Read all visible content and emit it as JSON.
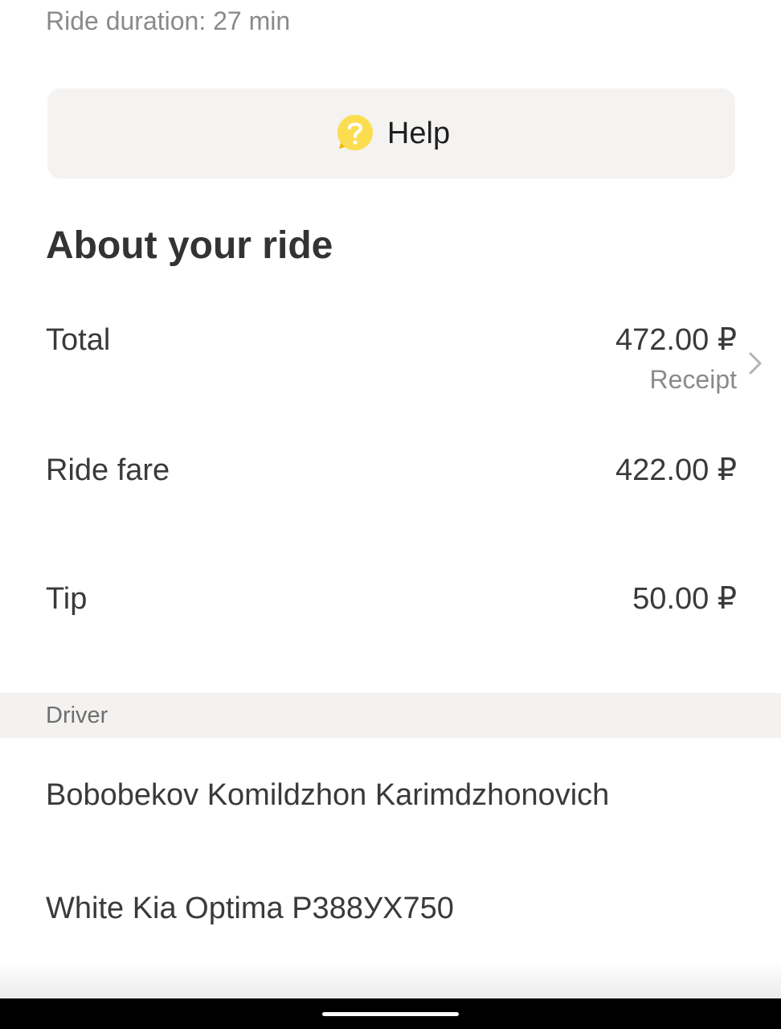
{
  "ride": {
    "duration_text": "Ride duration: 27 min"
  },
  "help_button": {
    "label": "Help",
    "icon": "question-bubble-icon",
    "icon_color": "#fcdd4f"
  },
  "about": {
    "title": "About your ride",
    "total": {
      "label": "Total",
      "value": "472.00 ₽",
      "sub_label": "Receipt"
    },
    "ride_fare": {
      "label": "Ride fare",
      "value": "422.00 ₽"
    },
    "tip": {
      "label": "Tip",
      "value": "50.00 ₽"
    }
  },
  "driver": {
    "section_label": "Driver",
    "name": "Bobobekov Komildzhon Karimdzhonovich",
    "car": "White Kia Optima Р388УХ750"
  }
}
